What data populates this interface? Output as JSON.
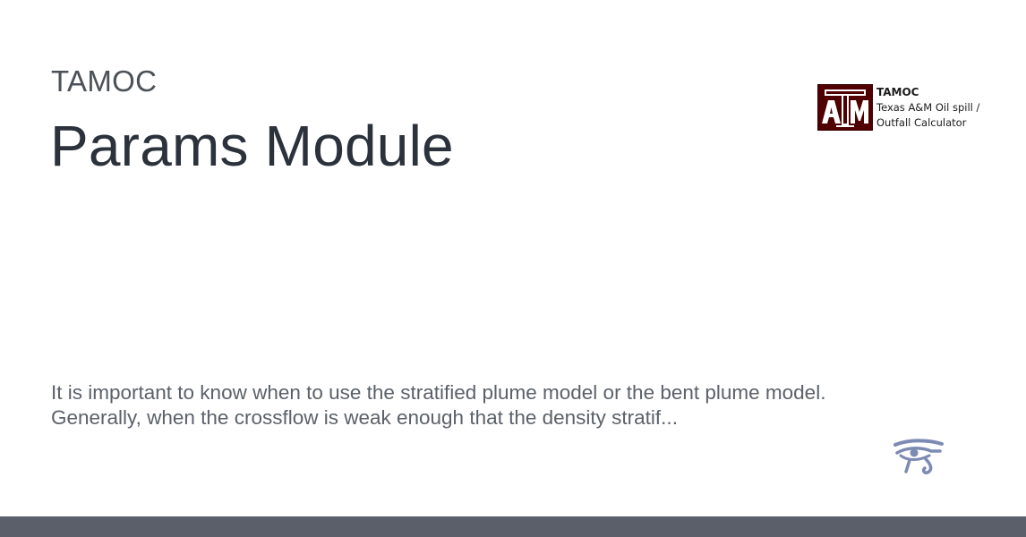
{
  "header": {
    "site_name": "TAMOC",
    "title": "Params Module"
  },
  "logo": {
    "mark_text": "ATM",
    "brand": "TAMOC",
    "tagline": "Texas A&M Oil spill /\nOutfall Calculator"
  },
  "description": "It is important to know when to use the stratified plume model or the bent plume model.\nGenerally, when the crossflow is weak enough that the density stratif...",
  "icons": {
    "footer_icon": "eye-of-horus-icon"
  },
  "colors": {
    "logo_maroon": "#500000",
    "footer_bar": "#5b5f6a",
    "title_text": "#2b323b",
    "eye_icon": "#7d8bb4"
  }
}
